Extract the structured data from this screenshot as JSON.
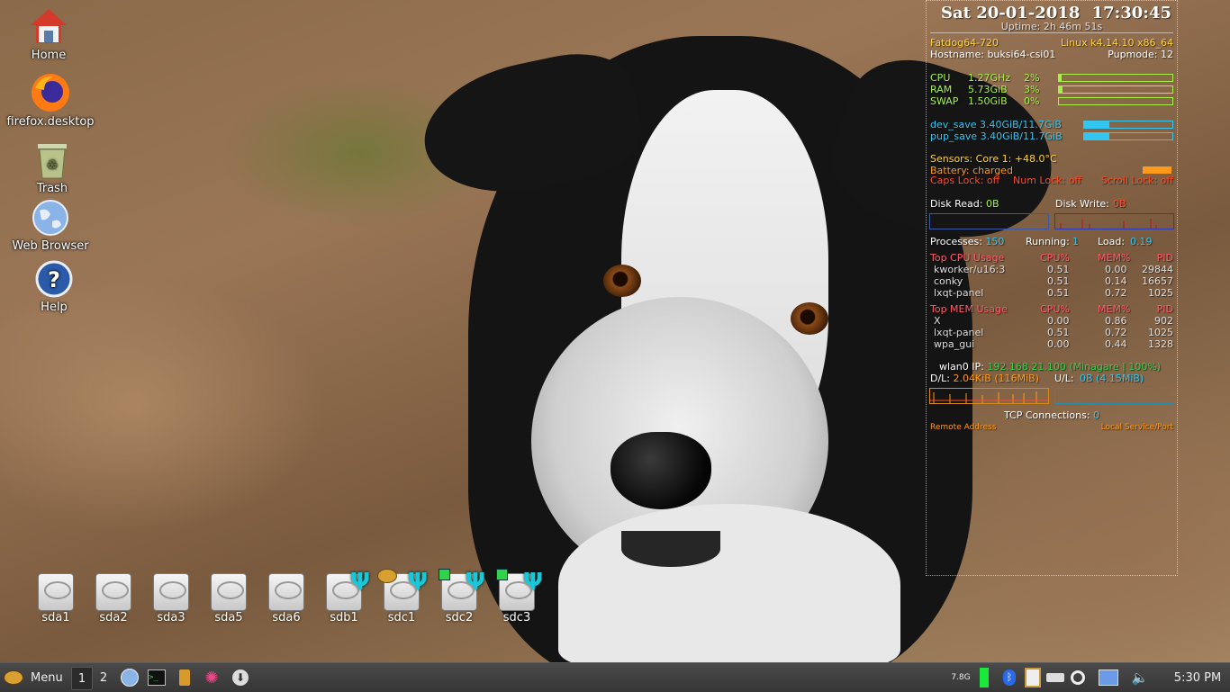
{
  "desktop_icons": [
    {
      "label": "Home",
      "icon": "home-icon"
    },
    {
      "label": "firefox.desktop",
      "icon": "firefox-icon"
    },
    {
      "label": "Trash",
      "icon": "trash-icon"
    },
    {
      "label": "Web Browser",
      "icon": "globe-icon"
    },
    {
      "label": "Help",
      "icon": "help-icon"
    }
  ],
  "drives": [
    {
      "label": "sda1",
      "usb": false,
      "badge": ""
    },
    {
      "label": "sda2",
      "usb": false,
      "badge": ""
    },
    {
      "label": "sda3",
      "usb": false,
      "badge": ""
    },
    {
      "label": "sda5",
      "usb": false,
      "badge": ""
    },
    {
      "label": "sda6",
      "usb": false,
      "badge": ""
    },
    {
      "label": "sdb1",
      "usb": true,
      "badge": ""
    },
    {
      "label": "sdc1",
      "usb": true,
      "badge": "pup"
    },
    {
      "label": "sdc2",
      "usb": true,
      "badge": "mounted"
    },
    {
      "label": "sdc3",
      "usb": true,
      "badge": "mounted"
    }
  ],
  "conky": {
    "date": "Sat 20-01-2018",
    "time": "17:30:45",
    "uptime": "Uptime: 2h 46m 51s",
    "distro": "Fatdog64-720",
    "kernel": "Linux  k4.14.10  x86_64",
    "hostname": "Hostname: buksi64-csi01",
    "pupmode": "Pupmode: 12",
    "cpu": {
      "label": "CPU",
      "freq": "1.27GHz",
      "pct": "2%",
      "level": 0.02
    },
    "ram": {
      "label": "RAM",
      "freq": "5.73GiB",
      "pct": "3%",
      "level": 0.03
    },
    "swap": {
      "label": "SWAP",
      "freq": "1.50GiB",
      "pct": "0%",
      "level": 0.0
    },
    "dev_save": {
      "text": "dev_save 3.40GiB/11.7GiB",
      "level": 0.29
    },
    "pup_save": {
      "text": "pup_save 3.40GiB/11.7GiB",
      "level": 0.29
    },
    "sensors": "Sensors:  Core 1: +48.0°C",
    "battery": "Battery: charged",
    "locks": {
      "caps": "Caps Lock: off",
      "num": "Num Lock: off",
      "scroll": "Scroll Lock: off"
    },
    "disk_read_label": "Disk Read:",
    "disk_read_value": "0B",
    "disk_write_label": "Disk Write:",
    "disk_write_value": "0B",
    "processes_label": "Processes:",
    "processes_value": "150",
    "running_label": "Running:",
    "running_value": "1",
    "load_label": "Load:",
    "load_value": "0.19",
    "top_cpu": {
      "header": [
        "Top CPU Usage",
        "CPU%",
        "MEM%",
        "PID"
      ],
      "rows": [
        [
          "kworker/u16:3",
          "0.51",
          "0.00",
          "29844"
        ],
        [
          "conky",
          "0.51",
          "0.14",
          "16657"
        ],
        [
          "lxqt-panel",
          "0.51",
          "0.72",
          "1025"
        ]
      ]
    },
    "top_mem": {
      "header": [
        "Top MEM Usage",
        "CPU%",
        "MEM%",
        "PID"
      ],
      "rows": [
        [
          "X",
          "0.00",
          "0.86",
          "902"
        ],
        [
          "lxqt-panel",
          "0.51",
          "0.72",
          "1025"
        ],
        [
          "wpa_gui",
          "0.00",
          "0.44",
          "1328"
        ]
      ]
    },
    "wlan_label": "wlan0 IP:",
    "wlan_value": "192.168.21.100 (Minagare | 100%)",
    "dl_label": "D/L:",
    "dl_value": "2.04KiB  (116MiB)",
    "ul_label": "U/L:",
    "ul_value": "0B   (4.15MiB)",
    "tcp_label": "TCP Connections:",
    "tcp_value": "0",
    "remote_addr": "Remote Address",
    "local_port": "Local Service/Port"
  },
  "taskbar": {
    "menu_label": "Menu",
    "workspaces": [
      "1",
      "2"
    ],
    "launchers": [
      "globe-icon",
      "terminal-icon",
      "notes-icon",
      "pinwheel-icon",
      "download-icon"
    ],
    "mem_indicator": "7.8G",
    "tray": [
      "bluetooth-icon",
      "clipboard-icon",
      "drive-icon",
      "wifi-icon",
      "network-icon",
      "volume-icon"
    ],
    "clock": "5:30 PM"
  },
  "colors": {
    "accent_yellow": "#ffd23a",
    "accent_green": "#a6f04a",
    "accent_cyan": "#33c6f0",
    "accent_orange": "#ff9a1a",
    "accent_red": "#ff4a2a"
  }
}
